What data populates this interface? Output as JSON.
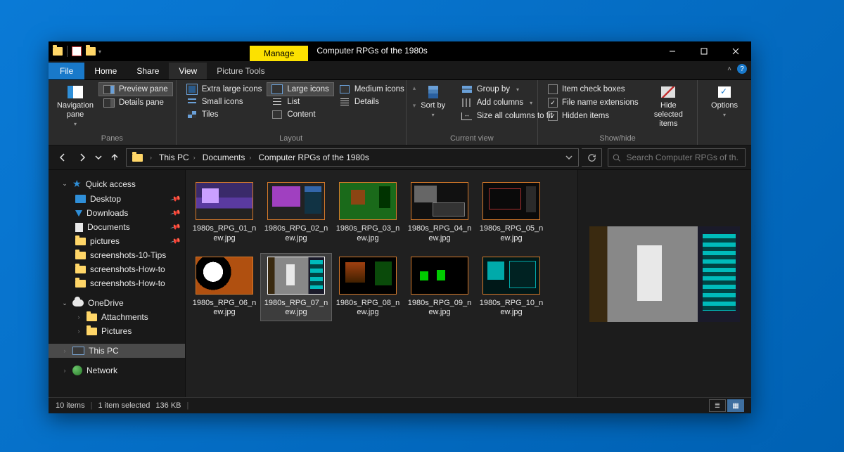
{
  "window": {
    "title": "Computer RPGs of the 1980s",
    "manage_tab": "Manage",
    "picture_tools": "Picture Tools"
  },
  "tabs": {
    "file": "File",
    "home": "Home",
    "share": "Share",
    "view": "View"
  },
  "ribbon": {
    "panes": {
      "label": "Panes",
      "navigation": "Navigation pane",
      "preview": "Preview pane",
      "details": "Details pane"
    },
    "layout": {
      "label": "Layout",
      "xl": "Extra large icons",
      "l": "Large icons",
      "m": "Medium icons",
      "s": "Small icons",
      "list": "List",
      "details": "Details",
      "tiles": "Tiles",
      "content": "Content"
    },
    "current": {
      "label": "Current view",
      "sort": "Sort by",
      "group": "Group by",
      "add_cols": "Add columns",
      "size_all": "Size all columns to fit"
    },
    "showhide": {
      "label": "Show/hide",
      "checkboxes": "Item check boxes",
      "ext": "File name extensions",
      "hidden": "Hidden items",
      "hide_sel": "Hide selected items"
    },
    "options": "Options"
  },
  "breadcrumb": {
    "root": "This PC",
    "p1": "Documents",
    "p2": "Computer RPGs of the 1980s"
  },
  "search": {
    "placeholder": "Search Computer RPGs of th..."
  },
  "sidebar": {
    "quick": "Quick access",
    "desktop": "Desktop",
    "downloads": "Downloads",
    "documents": "Documents",
    "pictures": "pictures",
    "s1": "screenshots-10-Tips",
    "s2": "screenshots-How-to",
    "s3": "screenshots-How-to",
    "onedrive": "OneDrive",
    "attachments": "Attachments",
    "od_pictures": "Pictures",
    "thispc": "This PC",
    "network": "Network"
  },
  "files": [
    {
      "name": "1980s_RPG_01_new.jpg",
      "g": "g1"
    },
    {
      "name": "1980s_RPG_02_new.jpg",
      "g": "g2"
    },
    {
      "name": "1980s_RPG_03_new.jpg",
      "g": "g3"
    },
    {
      "name": "1980s_RPG_04_new.jpg",
      "g": "g4"
    },
    {
      "name": "1980s_RPG_05_new.jpg",
      "g": "g5"
    },
    {
      "name": "1980s_RPG_06_new.jpg",
      "g": "g6"
    },
    {
      "name": "1980s_RPG_07_new.jpg",
      "g": "g7"
    },
    {
      "name": "1980s_RPG_08_new.jpg",
      "g": "g8"
    },
    {
      "name": "1980s_RPG_09_new.jpg",
      "g": "g9"
    },
    {
      "name": "1980s_RPG_10_new.jpg",
      "g": "g10"
    }
  ],
  "selected_index": 6,
  "status": {
    "count": "10 items",
    "sel": "1 item selected",
    "size": "136 KB"
  }
}
